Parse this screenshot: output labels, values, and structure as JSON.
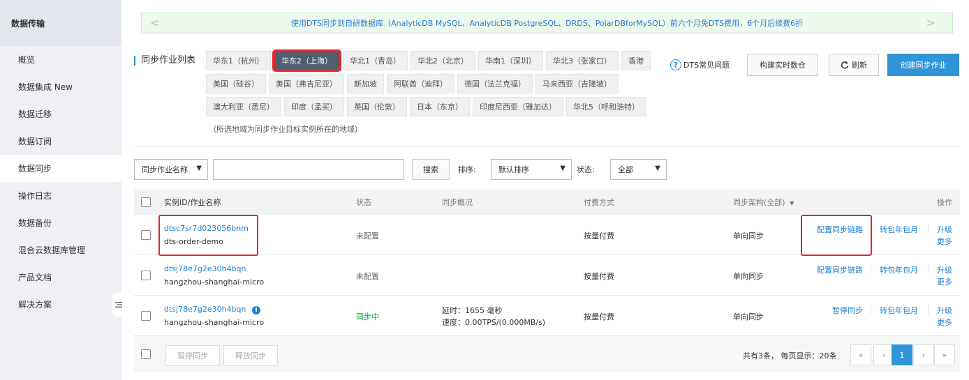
{
  "sidebar": {
    "title": "数据传输",
    "items": [
      {
        "label": "概览"
      },
      {
        "label": "数据集成  New"
      },
      {
        "label": "数据迁移"
      },
      {
        "label": "数据订阅"
      },
      {
        "label": "数据同步"
      },
      {
        "label": "操作日志"
      },
      {
        "label": "数据备份"
      },
      {
        "label": "混合云数据库管理"
      },
      {
        "label": "产品文档"
      },
      {
        "label": "解决方案"
      }
    ],
    "active_index": 4
  },
  "promo": {
    "text": "使用DTS同步到自研数据库（AnalyticDB MySQL、AnalyticDB PostgreSQL、DRDS、PolarDBforMySQL）前六个月免DTS费用，6个月后续费6折",
    "prev": "<",
    "next": ">"
  },
  "header": {
    "title": "同步作业列表",
    "faq": "DTS常见问题",
    "build_btn": "构建实时数仓",
    "refresh_btn": "刷新",
    "create_btn": "创建同步作业"
  },
  "regions": {
    "rows": [
      [
        "华东1（杭州）",
        "华东2（上海）",
        "华北1（青岛）",
        "华北2（北京）",
        "华南1（深圳）",
        "华北3（张家口）",
        "香港"
      ],
      [
        "美国（硅谷）",
        "美国（弗吉尼亚）",
        "新加坡",
        "阿联酋（迪拜）",
        "德国（法兰克福）",
        "马来西亚（吉隆坡）"
      ],
      [
        "澳大利亚（悉尼）",
        "印度（孟买）",
        "英国（伦敦）",
        "日本（东京）",
        "印度尼西亚（雅加达）",
        "华北5（呼和浩特）"
      ]
    ],
    "active": "华东2（上海）",
    "note": "（所选地域为同步作业目标实例所在的地域）"
  },
  "filter": {
    "field_select": "同步作业名称",
    "search_btn": "搜索",
    "sort_label": "排序:",
    "sort_value": "默认排序",
    "status_label": "状态:",
    "status_value": "全部"
  },
  "table": {
    "columns": {
      "name": "实例ID/作业名称",
      "status": "状态",
      "overview": "同步概况",
      "pay": "付费方式",
      "arch": "同步架构(全部)",
      "ops": "操作"
    },
    "rows": [
      {
        "id": "dtsc7sr7d023056bnm",
        "name": "dts-order-demo",
        "status": "未配置",
        "overview1": "",
        "overview2": "",
        "pay": "按量付费",
        "arch": "单向同步",
        "op1": "配置同步链路",
        "op2": "转包年包月",
        "op3": "升级",
        "op4": "更多"
      },
      {
        "id": "dtsj78e7g2e30h4bqn",
        "name": "hangzhou-shanghai-micro",
        "status": "未配置",
        "overview1": "",
        "overview2": "",
        "pay": "按量付费",
        "arch": "单向同步",
        "op1": "配置同步链路",
        "op2": "转包年包月",
        "op3": "升级",
        "op4": "更多"
      },
      {
        "id": "dtsj78e7g2e30h4bqn",
        "name": "hangzhou-shanghai-micro",
        "status": "同步中",
        "overview1": "延时：1655 毫秒",
        "overview2": "速度：0.00TPS/(0.000MB/s)",
        "pay": "按量付费",
        "arch": "单向同步",
        "op1": "暂停同步",
        "op2": "转包年包月",
        "op3": "升级",
        "op4": "更多"
      }
    ]
  },
  "footer": {
    "pause_btn": "暂停同步",
    "release_btn": "释放同步",
    "summary": "共有3条，  每页显示：20条",
    "pages": {
      "first": "«",
      "prev": "‹",
      "current": "1",
      "next": "›",
      "last": "»"
    }
  }
}
